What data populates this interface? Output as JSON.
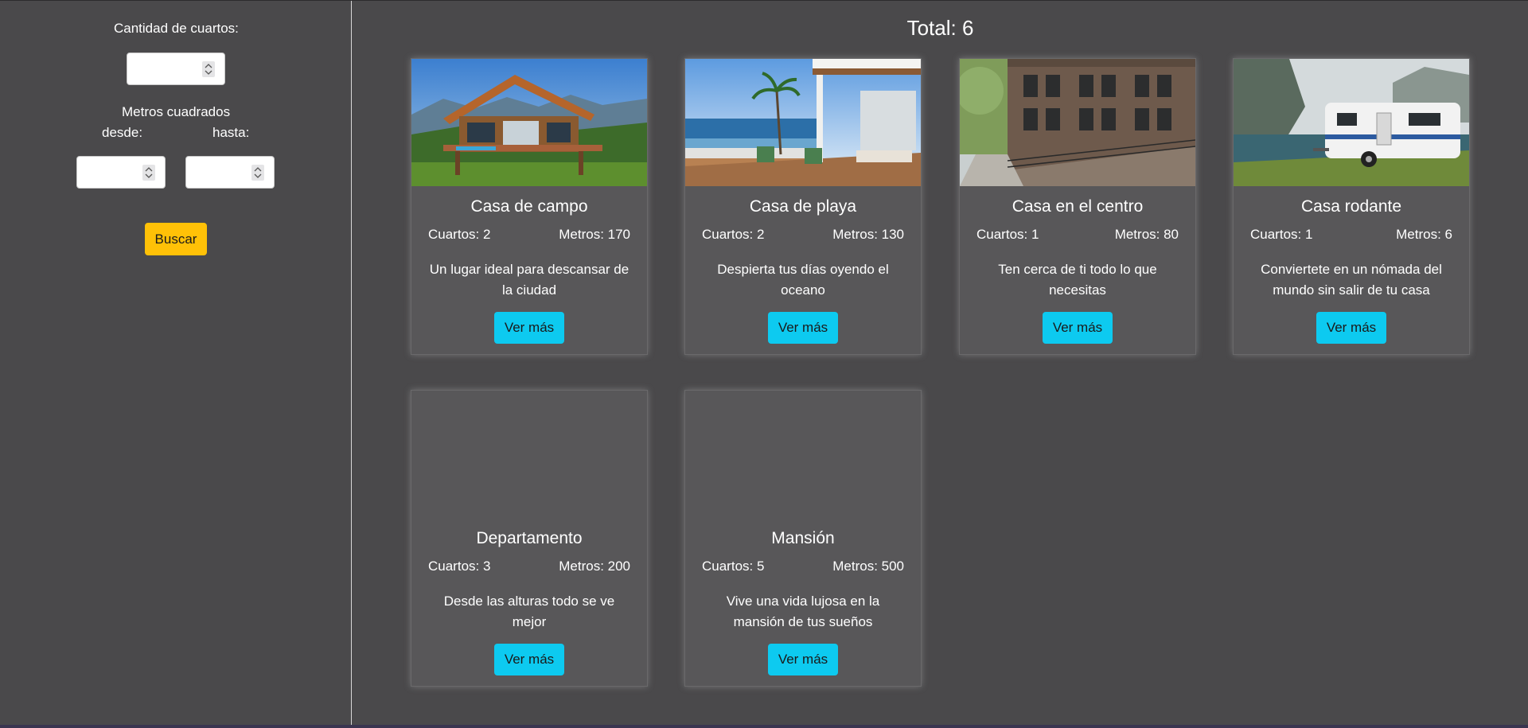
{
  "filters": {
    "rooms_label": "Cantidad de cuartos:",
    "meters_label": "Metros cuadrados",
    "from_label": "desde:",
    "to_label": "hasta:",
    "search_button": "Buscar"
  },
  "results": {
    "total_text": "Total: 6"
  },
  "cards": [
    {
      "title": "Casa de campo",
      "rooms": "Cuartos: 2",
      "meters": "Metros: 170",
      "description": "Un lugar ideal para descansar de la ciudad",
      "button": "Ver más"
    },
    {
      "title": "Casa de playa",
      "rooms": "Cuartos: 2",
      "meters": "Metros: 130",
      "description": "Despierta tus días oyendo el oceano",
      "button": "Ver más"
    },
    {
      "title": "Casa en el centro",
      "rooms": "Cuartos: 1",
      "meters": "Metros: 80",
      "description": "Ten cerca de ti todo lo que necesitas",
      "button": "Ver más"
    },
    {
      "title": "Casa rodante",
      "rooms": "Cuartos: 1",
      "meters": "Metros: 6",
      "description": "Conviertete en un nómada del mundo sin salir de tu casa",
      "button": "Ver más"
    },
    {
      "title": "Departamento",
      "rooms": "Cuartos: 3",
      "meters": "Metros: 200",
      "description": "Desde las alturas todo se ve mejor",
      "button": "Ver más"
    },
    {
      "title": "Mansión",
      "rooms": "Cuartos: 5",
      "meters": "Metros: 500",
      "description": "Vive una vida lujosa en la mansión de tus sueños",
      "button": "Ver más"
    }
  ],
  "colors": {
    "background": "#4a494b",
    "card": "#585759",
    "search_button": "#ffc107",
    "more_button": "#0dcaf0"
  }
}
